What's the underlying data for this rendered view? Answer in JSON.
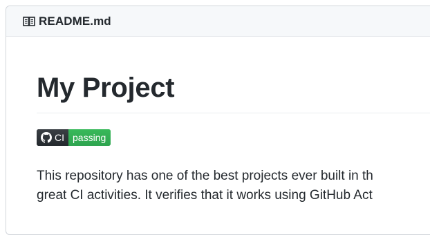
{
  "readme": {
    "icon": "book-icon",
    "filename": "README.md"
  },
  "content": {
    "title": "My Project",
    "badge": {
      "icon": "github-icon",
      "label": "CI",
      "status": "passing",
      "status_color": "#2ea44f",
      "label_color": "#24292e"
    },
    "paragraph_lines": [
      "This repository has one of the best projects ever built in th",
      "great CI activities. It verifies that it works using GitHub Act"
    ]
  }
}
